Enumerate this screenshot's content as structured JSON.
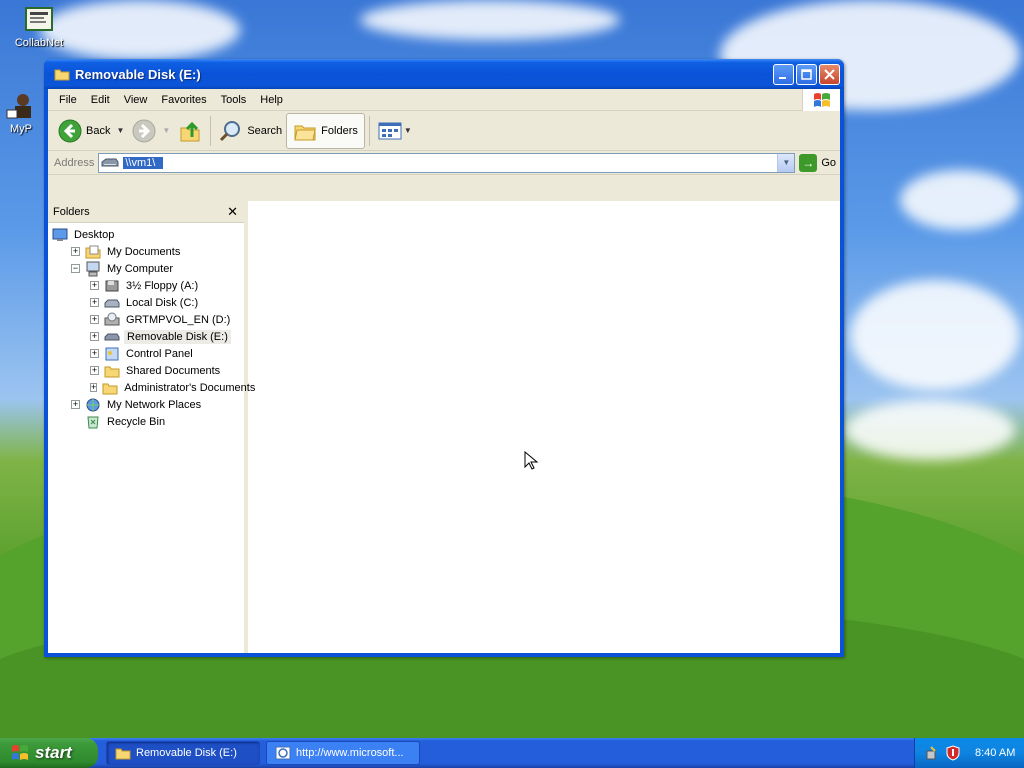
{
  "desktop": {
    "icons": [
      {
        "label": "CollabNet"
      },
      {
        "label": "MyP"
      }
    ]
  },
  "window": {
    "title": "Removable Disk (E:)",
    "menu": [
      "File",
      "Edit",
      "View",
      "Favorites",
      "Tools",
      "Help"
    ],
    "toolbar": {
      "back_label": "Back",
      "search_label": "Search",
      "folders_label": "Folders"
    },
    "address": {
      "label": "Address",
      "value": "\\\\vm1\\",
      "go_label": "Go"
    },
    "folders_pane": {
      "title": "Folders",
      "tree": [
        {
          "label": "Desktop",
          "level": 0,
          "expander": "none",
          "icon": "desktop-icon"
        },
        {
          "label": "My Documents",
          "level": 1,
          "expander": "+",
          "icon": "my-documents-icon"
        },
        {
          "label": "My Computer",
          "level": 1,
          "expander": "-",
          "icon": "my-computer-icon"
        },
        {
          "label": "3½ Floppy (A:)",
          "level": 2,
          "expander": "+",
          "icon": "floppy-drive-icon"
        },
        {
          "label": "Local Disk (C:)",
          "level": 2,
          "expander": "+",
          "icon": "hard-disk-icon"
        },
        {
          "label": "GRTMPVOL_EN (D:)",
          "level": 2,
          "expander": "+",
          "icon": "cd-drive-icon"
        },
        {
          "label": "Removable Disk (E:)",
          "level": 2,
          "expander": "+",
          "icon": "removable-disk-icon",
          "selected": true
        },
        {
          "label": "Control Panel",
          "level": 2,
          "expander": "+",
          "icon": "control-panel-icon"
        },
        {
          "label": "Shared Documents",
          "level": 2,
          "expander": "+",
          "icon": "folder-icon"
        },
        {
          "label": "Administrator's Documents",
          "level": 2,
          "expander": "+",
          "icon": "folder-icon"
        },
        {
          "label": "My Network Places",
          "level": 1,
          "expander": "+",
          "icon": "network-places-icon"
        },
        {
          "label": "Recycle Bin",
          "level": 1,
          "expander": "none",
          "icon": "recycle-bin-icon"
        }
      ]
    }
  },
  "taskbar": {
    "start_label": "start",
    "tasks": [
      {
        "label": "Removable Disk (E:)",
        "active": true
      },
      {
        "label": "http://www.microsoft...",
        "active": false
      }
    ],
    "clock": "8:40 AM"
  }
}
